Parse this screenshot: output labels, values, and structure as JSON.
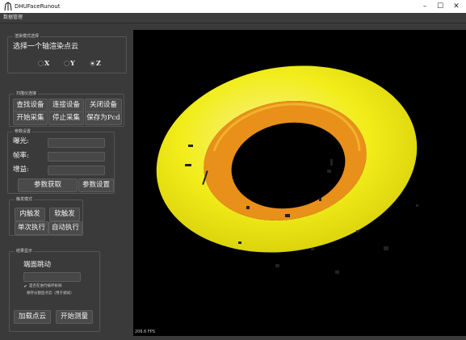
{
  "window": {
    "title": "DHUFaceRunout",
    "minimize": "–",
    "maximize": "☐",
    "close": "✕"
  },
  "menu": {
    "items": [
      "数据管理"
    ]
  },
  "render_mode": {
    "group_title": "渲染模式选择",
    "prompt": "选择一个轴渲染点云",
    "options": [
      {
        "label": "X",
        "selected": false
      },
      {
        "label": "Y",
        "selected": false
      },
      {
        "label": "Z",
        "selected": true
      }
    ]
  },
  "scan_device": {
    "group_title": "扫描仪连接",
    "buttons": [
      "查找设备",
      "连接设备",
      "关闭设备",
      "开始采集",
      "停止采集",
      "保存为Pcd"
    ]
  },
  "params": {
    "group_title": "参数设置",
    "exposure_label": "曝光:",
    "exposure_value": "",
    "framerate_label": "帧率:",
    "framerate_value": "",
    "gain_label": "增益:",
    "gain_value": "",
    "get_button": "参数获取",
    "set_button": "参数设置"
  },
  "trigger": {
    "group_title": "触发模式",
    "buttons": [
      "内触发",
      "软触发",
      "单次执行",
      "自动执行"
    ]
  },
  "result": {
    "group_title": "结果显示",
    "runout_label": "端面跳动",
    "runout_value": "",
    "checkbox1_label": "是否在进行按环拆除",
    "checkbox1_checked": true,
    "checkbox2_label": "保存分割后点云（用于调试）",
    "checkbox2_checked": false,
    "load_button": "加载点云",
    "measure_button": "开始测量"
  },
  "viewer": {
    "fps_text": "206.6 FPS"
  },
  "colors": {
    "background": "#3a3a3a",
    "viewport": "#000000",
    "pointcloud_outer": "#f5f01c",
    "pointcloud_inner": "#e8901a"
  }
}
